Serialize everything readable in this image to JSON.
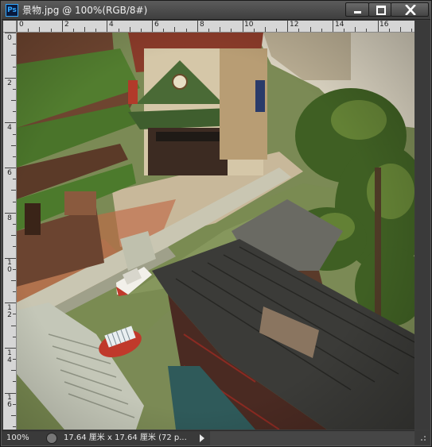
{
  "window": {
    "app_icon": "Ps",
    "title": "景物.jpg @ 100%(RGB/8#)",
    "controls": [
      "minimize-icon",
      "maximize-icon",
      "close-icon"
    ]
  },
  "rulers": {
    "top_labels": [
      "0",
      "2",
      "4",
      "6",
      "8",
      "10",
      "12",
      "14",
      "16"
    ],
    "left_labels": [
      "0",
      "2",
      "4",
      "6",
      "8",
      "1\n0",
      "1\n2",
      "1\n4",
      "1\n6"
    ]
  },
  "canvas": {
    "description": "painted illustration",
    "colors": {
      "water": "#7a8b52",
      "roof_green": "#4f7a2e",
      "roof_dark": "#3b3b38",
      "wood": "#6e4530",
      "tree": "#3f5f23",
      "sky": "#e6e2d6"
    }
  },
  "status": {
    "zoom": "100%",
    "doc_info": "17.64 厘米 x 17.64 厘米 (72 p..."
  }
}
